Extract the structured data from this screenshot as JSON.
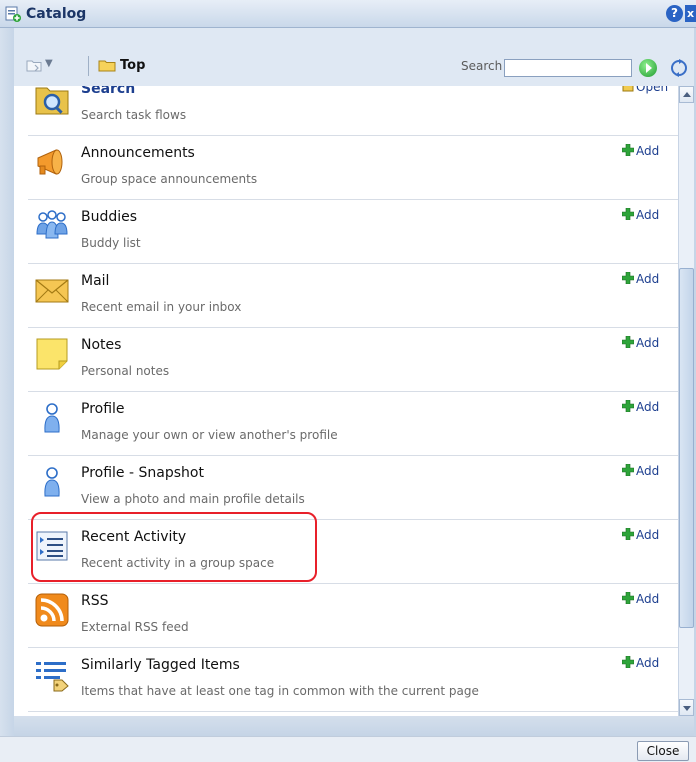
{
  "window": {
    "title": "Catalog",
    "help_label": "?",
    "close_label": "x"
  },
  "toolbar": {
    "location_label": "Top",
    "search_label": "Search",
    "search_value": "",
    "search_placeholder": ""
  },
  "items": [
    {
      "name": "Search",
      "description": "Search task flows",
      "action": "Open",
      "icon": "magnifier-folder-icon"
    },
    {
      "name": "Announcements",
      "description": "Group space announcements",
      "action": "Add",
      "icon": "megaphone-icon"
    },
    {
      "name": "Buddies",
      "description": "Buddy list",
      "action": "Add",
      "icon": "buddies-icon"
    },
    {
      "name": "Mail",
      "description": "Recent email in your inbox",
      "action": "Add",
      "icon": "envelope-icon"
    },
    {
      "name": "Notes",
      "description": "Personal notes",
      "action": "Add",
      "icon": "note-icon"
    },
    {
      "name": "Profile",
      "description": "Manage your own or view another's profile",
      "action": "Add",
      "icon": "person-icon"
    },
    {
      "name": "Profile - Snapshot",
      "description": "View a photo and main profile details",
      "action": "Add",
      "icon": "person-icon"
    },
    {
      "name": "Recent Activity",
      "description": "Recent activity in a group space",
      "action": "Add",
      "icon": "activity-list-icon"
    },
    {
      "name": "RSS",
      "description": "External RSS feed",
      "action": "Add",
      "icon": "rss-icon"
    },
    {
      "name": "Similarly Tagged Items",
      "description": "Items that have at least one tag in common with the current page",
      "action": "Add",
      "icon": "tagged-list-icon"
    }
  ],
  "footer": {
    "close_label": "Close"
  },
  "colors": {
    "highlight": "#e8202a",
    "link": "#1d3f8f",
    "title": "#1b3566"
  }
}
